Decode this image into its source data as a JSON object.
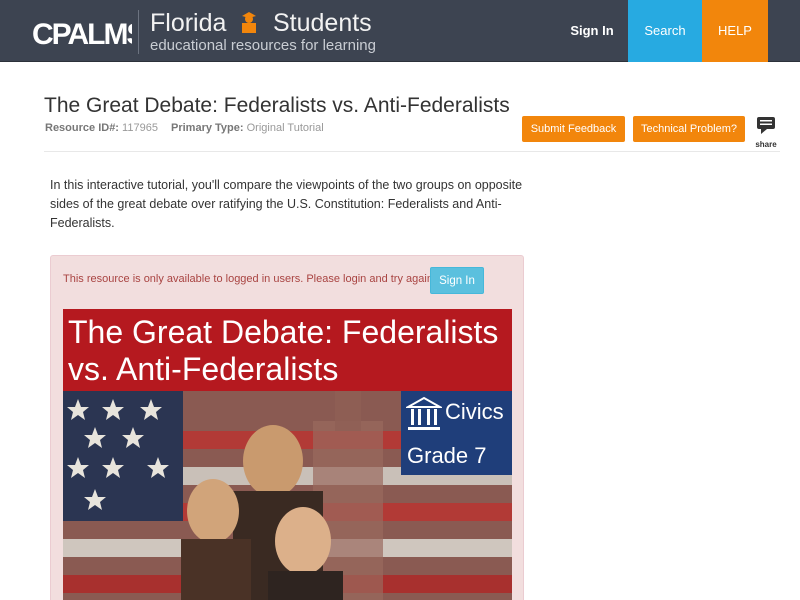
{
  "header": {
    "logo_text": "CPALMS",
    "brand_title_1": "Florida",
    "brand_title_2": "Students",
    "brand_subtitle": "educational resources for learning",
    "nav": {
      "signin": "Sign In",
      "search": "Search",
      "help": "HELP"
    },
    "colors": {
      "bar": "#3d4451",
      "search": "#27aae1",
      "help": "#f2860c"
    }
  },
  "resource": {
    "title": "The Great Debate: Federalists vs. Anti-Federalists",
    "id_label": "Resource ID#:",
    "id_value": "117965",
    "type_label": "Primary Type:",
    "type_value": "Original Tutorial",
    "buttons": {
      "feedback": "Submit Feedback",
      "technical": "Technical Problem?",
      "share": "share"
    },
    "description": "In this interactive tutorial, you'll compare the viewpoints of the two groups on opposite sides of the great debate over ratifying the U.S. Constitution: Federalists and Anti-Federalists."
  },
  "alert": {
    "message": "This resource is only available to logged in users. Please login and try again.",
    "signin": "Sign In"
  },
  "banner": {
    "title": "The Great Debate: Federalists vs. Anti-Federalists",
    "subject": "Civics",
    "grade": "Grade 7",
    "icon": "government-building-icon"
  }
}
